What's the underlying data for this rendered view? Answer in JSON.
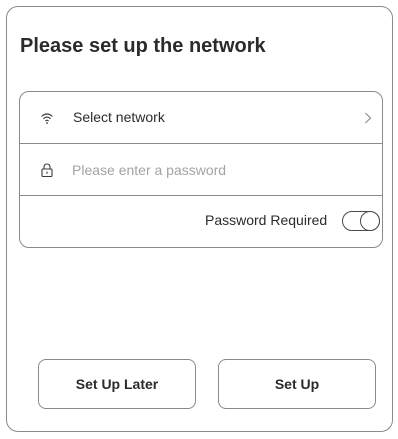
{
  "dialog": {
    "title": "Please set up the network"
  },
  "network": {
    "select_label": "Select network",
    "wifi_icon": "wifi-icon",
    "chevron_icon": "chevron-right-icon"
  },
  "password": {
    "placeholder": "Please enter a password",
    "value": "",
    "lock_icon": "lock-icon"
  },
  "password_required": {
    "label": "Password Required",
    "toggle_on": false
  },
  "buttons": {
    "later_label": "Set Up Later",
    "setup_label": "Set Up"
  },
  "colors": {
    "border": "#8a8a8a",
    "text": "#2b2b2b",
    "placeholder": "#a3a3a3"
  }
}
